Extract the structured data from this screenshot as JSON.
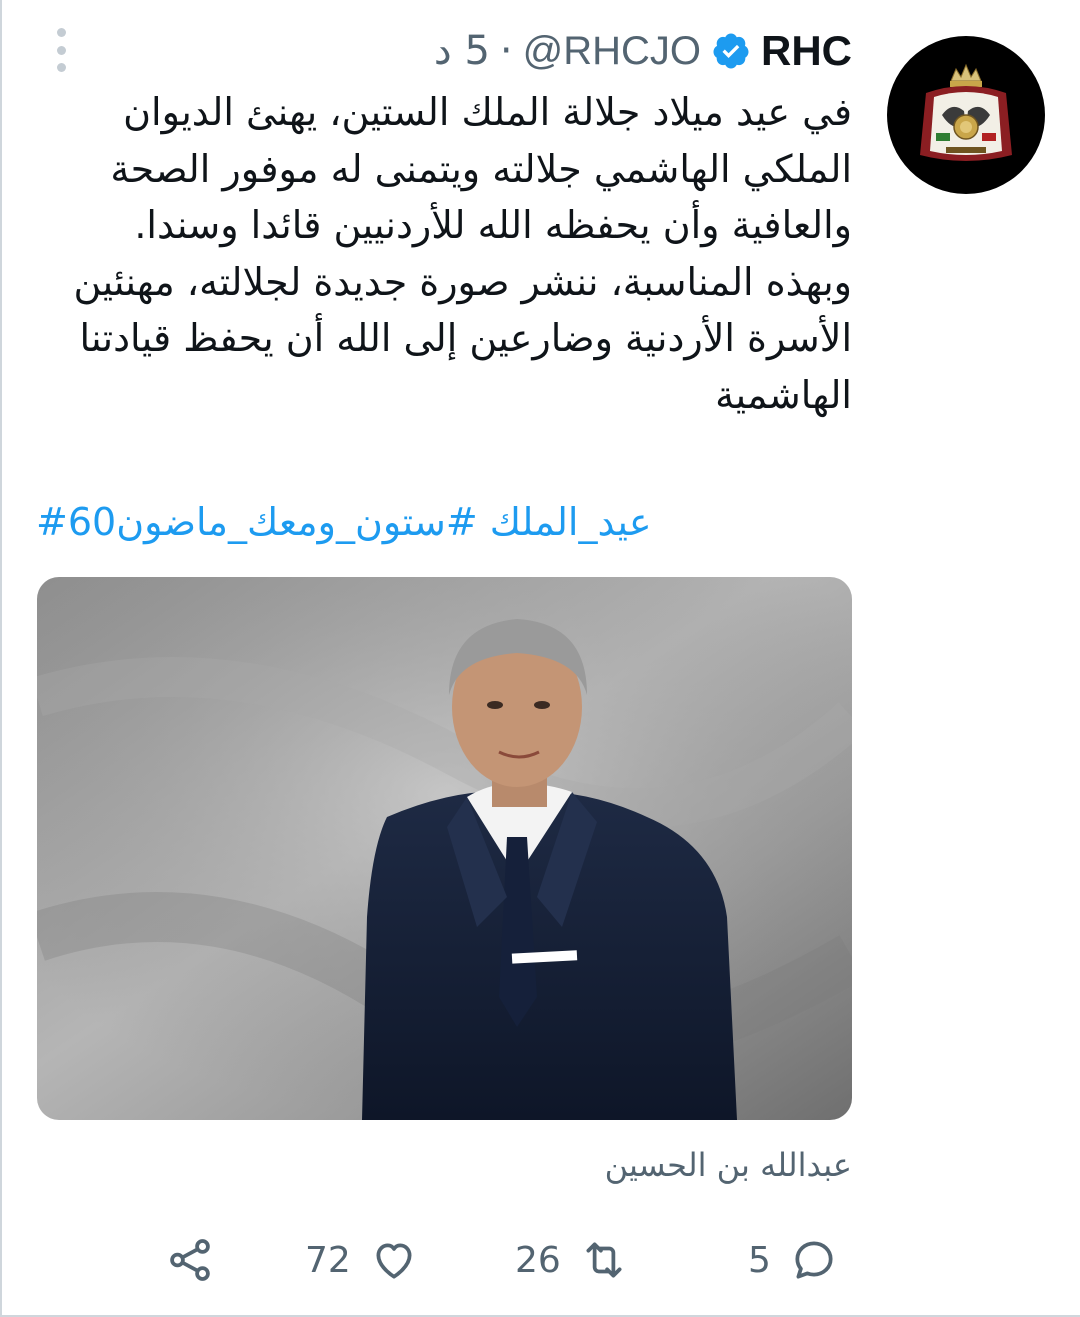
{
  "tweet": {
    "display_name": "RHC",
    "handle": "@RHCJO",
    "separator": "·",
    "time": "5 د",
    "text_lines": [
      "في عيد ميلاد جلالة الملك الستين، يهنئ الديوان",
      "الملكي الهاشمي جلالته ويتمنى له موفور الصحة",
      "والعافية وأن يحفظه الله للأردنيين قائدا وسندا.",
      "وبهذه المناسبة، ننشر صورة جديدة لجلالته، مهنئين",
      "الأسرة الأردنية وضارعين إلى الله أن يحفظ قيادتنا",
      "الهاشمية"
    ],
    "hashtags": "#60عيد_الملك #ستون_ومعك_ماضون",
    "photo_caption": "عبدالله بن الحسين"
  },
  "actions": {
    "replies": "5",
    "retweets": "26",
    "likes": "72"
  },
  "colors": {
    "accent": "#1d9bf0",
    "secondary_text": "#536471",
    "primary_text": "#0f1419"
  },
  "icons": [
    "more-vertical-icon",
    "verified-badge-icon",
    "reply-icon",
    "retweet-icon",
    "like-icon",
    "share-icon"
  ]
}
